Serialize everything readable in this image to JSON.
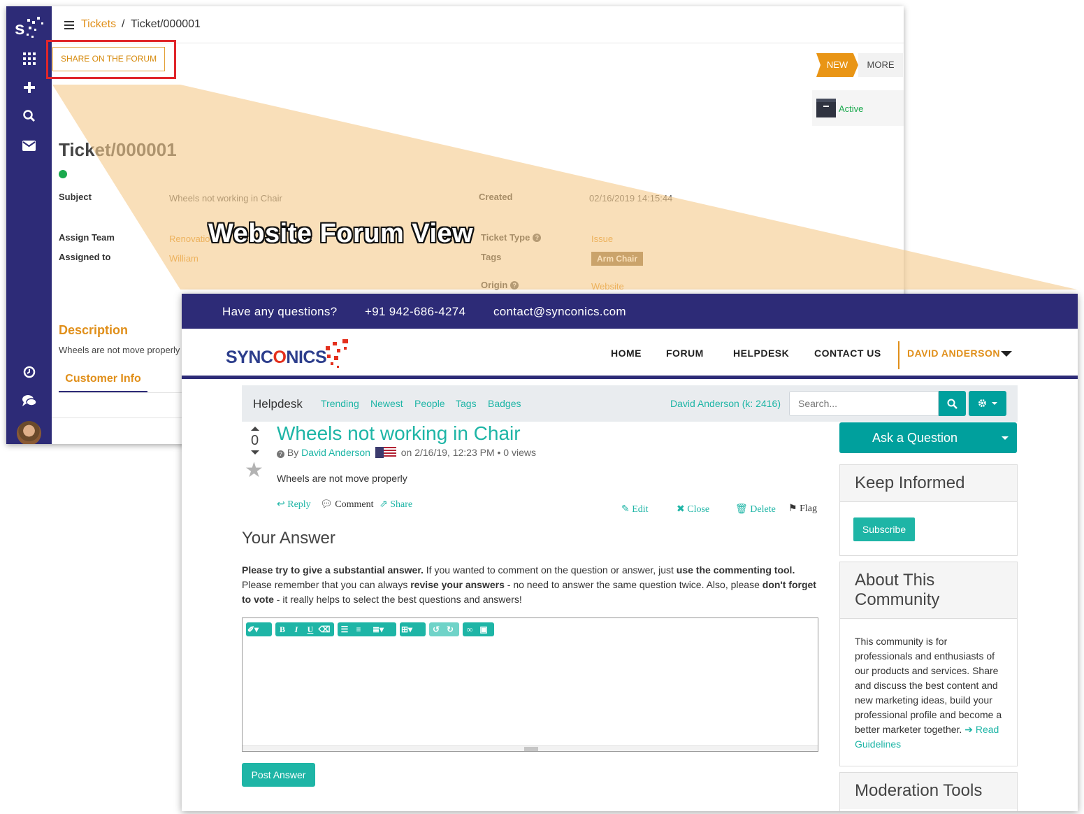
{
  "helpdesk": {
    "breadcrumb": {
      "root": "Tickets",
      "sep": "/",
      "current": "Ticket/000001"
    },
    "share_button": "SHARE ON THE FORUM",
    "status": {
      "new": "NEW",
      "more": "MORE",
      "active": "Active"
    },
    "ticket_title": "Ticket/000001",
    "fields": {
      "subject_label": "Subject",
      "subject_value": "Wheels not working in Chair",
      "created_label": "Created",
      "created_value": "02/16/2019 14:15:44",
      "assign_team_label": "Assign Team",
      "assign_team_value": "Renovatio",
      "assigned_to_label": "Assigned to",
      "assigned_to_value": "William",
      "ticket_type_label": "Ticket Type",
      "ticket_type_value": "Issue",
      "tags_label": "Tags",
      "tags_value": "Arm Chair",
      "origin_label": "Origin",
      "origin_value": "Website"
    },
    "description_heading": "Description",
    "description_text": "Wheels are not move properly",
    "customer_info_tab": "Customer Info"
  },
  "overlay_title": "Website Forum View",
  "website": {
    "top_strip": {
      "question": "Have any questions?",
      "phone": "+91 942-686-4274",
      "email": "contact@synconics.com"
    },
    "logo": {
      "part1": "SYNC",
      "part2": "O",
      "part3": "NICS"
    },
    "nav": {
      "home": "HOME",
      "forum": "FORUM",
      "helpdesk": "HELPDESK",
      "contact": "CONTACT US",
      "user": "DAVID ANDERSON"
    },
    "forum_bar": {
      "brand": "Helpdesk",
      "links": [
        "Trending",
        "Newest",
        "People",
        "Tags",
        "Badges"
      ],
      "user_karma": "David Anderson (k: 2416)",
      "search_placeholder": "Search..."
    },
    "question": {
      "votes": "0",
      "title": "Wheels not working in Chair",
      "by": "By",
      "author": "David Anderson",
      "meta_tail": "on 2/16/19, 12:23 PM • 0 views",
      "body": "Wheels are not move properly",
      "actions": {
        "reply": "Reply",
        "comment": "Comment",
        "share": "Share",
        "edit": "Edit",
        "close": "Close",
        "delete": "Delete",
        "flag": "Flag"
      }
    },
    "answer": {
      "heading": "Your Answer",
      "t1": "Please try to give a substantial answer.",
      "t2": " If you wanted to comment on the question or answer, just ",
      "t3": "use the commenting tool.",
      "t4": " Please remember that you can always ",
      "t5": "revise your answers",
      "t6": " - no need to answer the same question twice. Also, please ",
      "t7": "don't forget to vote",
      "t8": " - it really helps to select the best questions and answers!",
      "post_button": "Post Answer"
    },
    "sidebar": {
      "ask_button": "Ask a Question",
      "keep_informed": "Keep Informed",
      "subscribe": "Subscribe",
      "about_heading": "About This Community",
      "about_text": "This community is for professionals and enthusiasts of our products and services. Share and discuss the best content and new marketing ideas, build your professional profile and become a better marketer together.",
      "read_guidelines": "Read Guidelines",
      "moderation_heading": "Moderation Tools"
    }
  },
  "colors": {
    "sidebar_navy": "#2d2b77",
    "accent_orange": "#e08f1a",
    "teal": "#1eb5a6",
    "highlight_red": "#e0262b",
    "beam": "#f6d19e"
  }
}
